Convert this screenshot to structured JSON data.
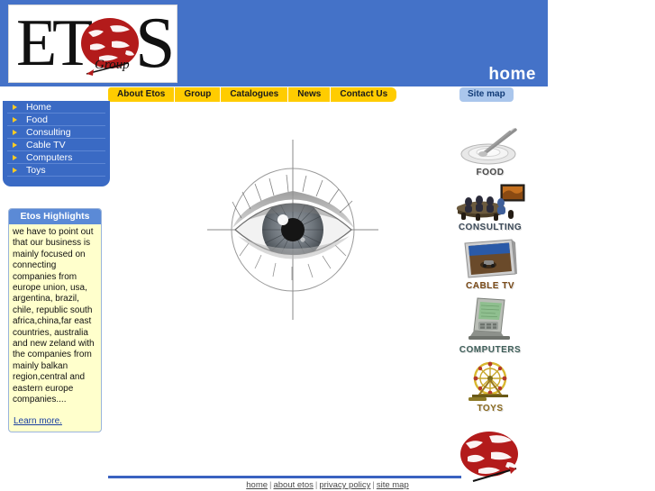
{
  "site": {
    "logo_text": "ETOS",
    "logo_tagline": "Group",
    "page_title": "home"
  },
  "topnav": {
    "items": [
      {
        "label": "About Etos"
      },
      {
        "label": "Group"
      },
      {
        "label": "Catalogues"
      },
      {
        "label": "News"
      },
      {
        "label": "Contact Us"
      }
    ],
    "sitemap_label": "Site map"
  },
  "sidebar": {
    "items": [
      {
        "label": "Home"
      },
      {
        "label": "Food"
      },
      {
        "label": "Consulting"
      },
      {
        "label": "Cable TV"
      },
      {
        "label": "Computers"
      },
      {
        "label": "Toys"
      }
    ]
  },
  "highlights": {
    "title": "Etos Highlights",
    "body": "we have to point out that our business is mainly focused on connecting companies from europe union, usa, argentina, brazil, chile, republic south africa,china,far east countries, australia and new zeland with the companies from mainly balkan region,central and eastern europe companies....",
    "link_label": "Learn more."
  },
  "main": {
    "hero_alt": "eye-crosshair-graphic"
  },
  "sections": [
    {
      "label": "FOOD",
      "icon": "food-photo"
    },
    {
      "label": "CONSULTING",
      "icon": "consulting-photo"
    },
    {
      "label": "CABLE TV",
      "icon": "cable-tv-photo"
    },
    {
      "label": "COMPUTERS",
      "icon": "computers-photo"
    },
    {
      "label": "TOYS",
      "icon": "toys-photo"
    }
  ],
  "footer": {
    "links": [
      {
        "label": "home"
      },
      {
        "label": "about etos"
      },
      {
        "label": "privacy policy"
      },
      {
        "label": "site map"
      }
    ],
    "separator": "|"
  },
  "colors": {
    "header_blue": "#4472c8",
    "sidebar_blue": "#3a6ac4",
    "tab_yellow": "#ffcc00",
    "sitemap_blue": "#aac6ec",
    "highlight_yellow": "#ffffcc",
    "globe_red": "#b31b1b"
  }
}
